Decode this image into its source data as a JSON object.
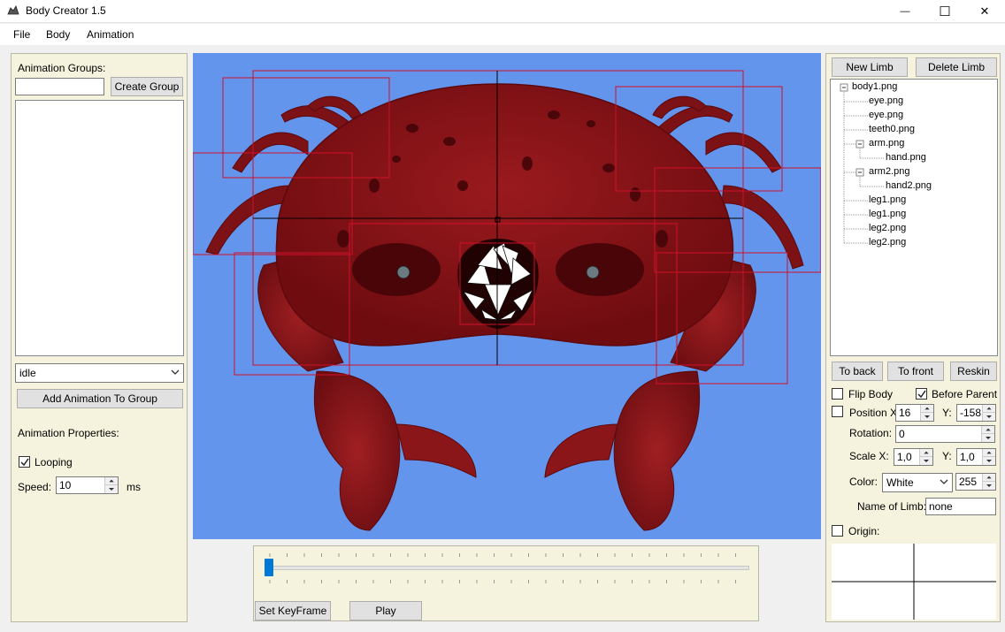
{
  "window": {
    "title": "Body Creator 1.5",
    "minimize_glyph": "—",
    "maximize_glyph": "☐",
    "close_glyph": "✕"
  },
  "menu": {
    "items": [
      "File",
      "Body",
      "Animation"
    ]
  },
  "left_panel": {
    "groups_label": "Animation Groups:",
    "group_name_value": "",
    "create_group_label": "Create Group",
    "animation_select_value": "idle",
    "add_animation_label": "Add Animation To Group",
    "properties_label": "Animation Properties:",
    "looping_label": "Looping",
    "looping_checked": true,
    "speed_label": "Speed:",
    "speed_value": "10",
    "speed_unit": "ms"
  },
  "timeline": {
    "slider_value": 0,
    "set_keyframe_label": "Set KeyFrame",
    "play_label": "Play"
  },
  "right_panel": {
    "new_limb_label": "New Limb",
    "delete_limb_label": "Delete Limb",
    "tree": [
      {
        "label": "body1.png",
        "depth": 0,
        "expander": "minus"
      },
      {
        "label": "eye.png",
        "depth": 1
      },
      {
        "label": "eye.png",
        "depth": 1
      },
      {
        "label": "teeth0.png",
        "depth": 1
      },
      {
        "label": "arm.png",
        "depth": 1,
        "expander": "minus"
      },
      {
        "label": "hand.png",
        "depth": 2
      },
      {
        "label": "arm2.png",
        "depth": 1,
        "expander": "minus"
      },
      {
        "label": "hand2.png",
        "depth": 2
      },
      {
        "label": "leg1.png",
        "depth": 1
      },
      {
        "label": "leg1.png",
        "depth": 1
      },
      {
        "label": "leg2.png",
        "depth": 1
      },
      {
        "label": "leg2.png",
        "depth": 1
      }
    ],
    "to_back_label": "To back",
    "to_front_label": "To front",
    "reskin_label": "Reskin",
    "flip_body_label": "Flip Body",
    "flip_body_checked": false,
    "before_parent_label": "Before Parent",
    "before_parent_checked": true,
    "position_label": "Position X:",
    "position_checked": false,
    "position_x_value": "16",
    "position_y_label": "Y:",
    "position_y_value": "-158",
    "rotation_label": "Rotation:",
    "rotation_value": "0",
    "scale_x_label": "Scale X:",
    "scale_x_value": "1,0",
    "scale_y_label": "Y:",
    "scale_y_value": "1,0",
    "color_label": "Color:",
    "color_value": "White",
    "alpha_value": "255",
    "limb_name_label": "Name of Limb:",
    "limb_name_value": "none",
    "origin_label": "Origin:",
    "origin_checked": false
  },
  "colors": {
    "panel_bg": "#f5f3dd",
    "canvas_bg": "#6495ed",
    "crab_body": "#8e1418",
    "selection_box": "#e0102a"
  }
}
